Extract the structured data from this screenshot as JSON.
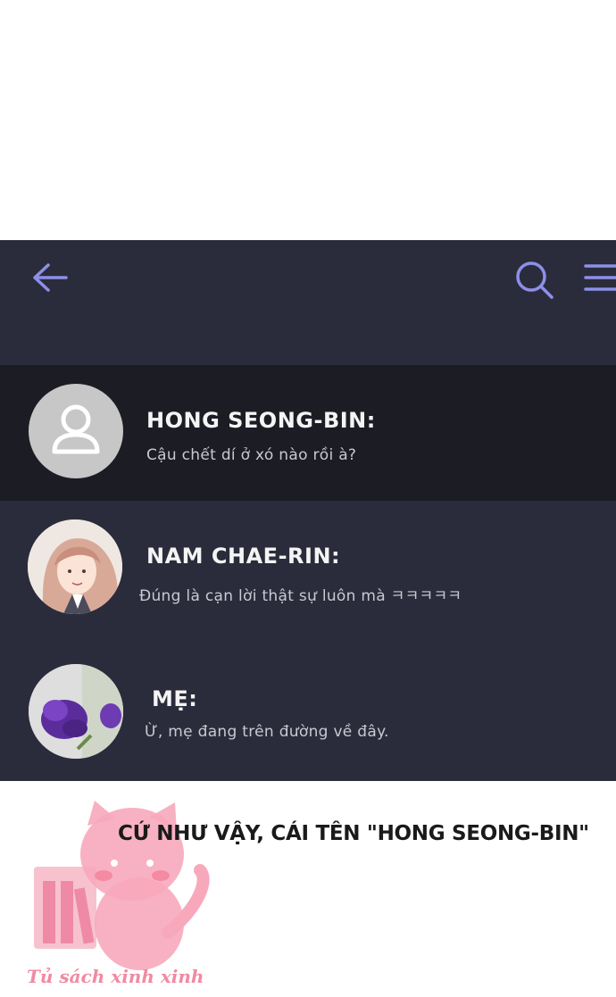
{
  "topbar": {
    "back_icon": "arrow-left-icon",
    "search_icon": "search-icon",
    "menu_icon": "hamburger-menu-icon",
    "accent": "#8e8fe9"
  },
  "chats": [
    {
      "name": "HONG SEONG-BIN:",
      "message": "Cậu chết dí ở xó nào rồi à?",
      "avatar": "default-user-avatar"
    },
    {
      "name": "NAM CHAE-RIN:",
      "message": "Đúng là cạn lời thật sự luôn mà ㅋㅋㅋㅋㅋ",
      "avatar": "girl-portrait-avatar"
    },
    {
      "name": "MẸ:",
      "message": "Ừ, mẹ đang trên đường về đây.",
      "avatar": "purple-flower-avatar"
    }
  ],
  "caption": "CỨ NHƯ VẬY, CÁI TÊN \"HONG SEONG-BIN\"",
  "watermark": {
    "text": "Tủ sách xinh xinh",
    "color": "#f08aa2"
  },
  "colors": {
    "panel": "#2b2c3b",
    "active_row": "#1c1c25"
  }
}
